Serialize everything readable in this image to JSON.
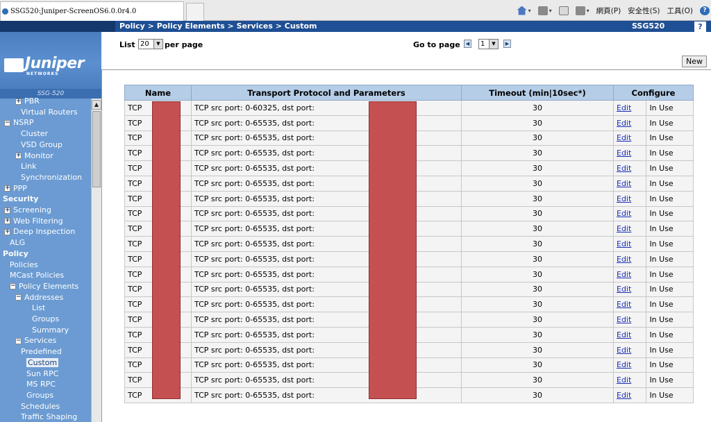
{
  "browser": {
    "tab_title": "SSG520:Juniper-ScreenOS6.0.0r4.0",
    "tools": {
      "page_menu": "網頁(P)",
      "safety_menu": "安全性(S)",
      "tools_menu": "工具(O)"
    }
  },
  "header": {
    "breadcrumb": "Policy > Policy Elements > Services > Custom",
    "device": "SSG520",
    "help_label": "?"
  },
  "logo": {
    "brand": "Juniper",
    "sub": "NETWORKS",
    "model": "SSG-520"
  },
  "nav": {
    "items": [
      {
        "label": "PBR",
        "expander": "+"
      },
      {
        "label": "Virtual Routers",
        "expander": ""
      },
      {
        "label": "NSRP",
        "expander": "−"
      },
      {
        "label": "Cluster",
        "expander": ""
      },
      {
        "label": "VSD Group",
        "expander": ""
      },
      {
        "label": "Monitor",
        "expander": "+"
      },
      {
        "label": "Link",
        "expander": ""
      },
      {
        "label": "Synchronization",
        "expander": ""
      },
      {
        "label": "PPP",
        "expander": "+"
      },
      {
        "label": "Security",
        "expander": ""
      },
      {
        "label": "Screening",
        "expander": "+"
      },
      {
        "label": "Web Filtering",
        "expander": "+"
      },
      {
        "label": "Deep Inspection",
        "expander": "+"
      },
      {
        "label": "ALG",
        "expander": ""
      },
      {
        "label": "Policy",
        "expander": ""
      },
      {
        "label": "Policies",
        "expander": ""
      },
      {
        "label": "MCast Policies",
        "expander": ""
      },
      {
        "label": "Policy Elements",
        "expander": "−"
      },
      {
        "label": "Addresses",
        "expander": "−"
      },
      {
        "label": "List",
        "expander": ""
      },
      {
        "label": "Groups",
        "expander": ""
      },
      {
        "label": "Summary",
        "expander": ""
      },
      {
        "label": "Services",
        "expander": "−"
      },
      {
        "label": "Predefined",
        "expander": ""
      },
      {
        "label": "Custom",
        "expander": ""
      },
      {
        "label": "Sun RPC",
        "expander": ""
      },
      {
        "label": "MS RPC",
        "expander": ""
      },
      {
        "label": "Groups",
        "expander": ""
      },
      {
        "label": "Schedules",
        "expander": ""
      },
      {
        "label": "Traffic Shaping",
        "expander": ""
      }
    ]
  },
  "controls": {
    "list_label": "List",
    "per_page_value": "20",
    "per_page_label": "per page",
    "goto_label": "Go to page",
    "page_value": "1",
    "new_label": "New"
  },
  "table": {
    "headers": [
      "Name",
      "Transport Protocol and Parameters",
      "Timeout (min|10sec*)",
      "Configure"
    ],
    "rows": [
      {
        "name": "TCP",
        "proto": "TCP src port: 0-60325, dst port:",
        "timeout": "30",
        "edit": "Edit",
        "status": "In Use"
      },
      {
        "name": "TCP",
        "proto": "TCP src port: 0-65535, dst port:",
        "timeout": "30",
        "edit": "Edit",
        "status": "In Use"
      },
      {
        "name": "TCP",
        "proto": "TCP src port: 0-65535, dst port:",
        "timeout": "30",
        "edit": "Edit",
        "status": "In Use"
      },
      {
        "name": "TCP",
        "proto": "TCP src port: 0-65535, dst port:",
        "timeout": "30",
        "edit": "Edit",
        "status": "In Use"
      },
      {
        "name": "TCP",
        "proto": "TCP src port: 0-65535, dst port:",
        "timeout": "30",
        "edit": "Edit",
        "status": "In Use"
      },
      {
        "name": "TCP",
        "proto": "TCP src port: 0-65535, dst port:",
        "timeout": "30",
        "edit": "Edit",
        "status": "In Use"
      },
      {
        "name": "TCP",
        "proto": "TCP src port: 0-65535, dst port:",
        "timeout": "30",
        "edit": "Edit",
        "status": "In Use"
      },
      {
        "name": "TCP",
        "proto": "TCP src port: 0-65535, dst port:",
        "timeout": "30",
        "edit": "Edit",
        "status": "In Use"
      },
      {
        "name": "TCP",
        "proto": "TCP src port: 0-65535, dst port:",
        "timeout": "30",
        "edit": "Edit",
        "status": "In Use"
      },
      {
        "name": "TCP",
        "proto": "TCP src port: 0-65535, dst port:",
        "timeout": "30",
        "edit": "Edit",
        "status": "In Use"
      },
      {
        "name": "TCP",
        "proto": "TCP src port: 0-65535, dst port:",
        "timeout": "30",
        "edit": "Edit",
        "status": "In Use"
      },
      {
        "name": "TCP",
        "proto": "TCP src port: 0-65535, dst port:",
        "timeout": "30",
        "edit": "Edit",
        "status": "In Use"
      },
      {
        "name": "TCP",
        "proto": "TCP src port: 0-65535, dst port:",
        "timeout": "30",
        "edit": "Edit",
        "status": "In Use"
      },
      {
        "name": "TCP",
        "proto": "TCP src port: 0-65535, dst port:",
        "timeout": "30",
        "edit": "Edit",
        "status": "In Use"
      },
      {
        "name": "TCP",
        "proto": "TCP src port: 0-65535, dst port:",
        "timeout": "30",
        "edit": "Edit",
        "status": "In Use"
      },
      {
        "name": "TCP",
        "proto": "TCP src port: 0-65535, dst port:",
        "timeout": "30",
        "edit": "Edit",
        "status": "In Use"
      },
      {
        "name": "TCP",
        "proto": "TCP src port: 0-65535, dst port:",
        "timeout": "30",
        "edit": "Edit",
        "status": "In Use"
      },
      {
        "name": "TCP",
        "proto": "TCP src port: 0-65535, dst port:",
        "timeout": "30",
        "edit": "Edit",
        "status": "In Use"
      },
      {
        "name": "TCP",
        "proto": "TCP src port: 0-65535, dst port:",
        "timeout": "30",
        "edit": "Edit",
        "status": "In Use"
      },
      {
        "name": "TCP",
        "proto": "TCP src port: 0-65535, dst port:",
        "timeout": "30",
        "edit": "Edit",
        "status": "In Use"
      }
    ]
  },
  "colors": {
    "header_bar": "#1f4f94",
    "sidebar": "#6b9bd2",
    "table_header": "#b5cde6",
    "link": "#1b2eb5",
    "redaction": "#c55052"
  }
}
